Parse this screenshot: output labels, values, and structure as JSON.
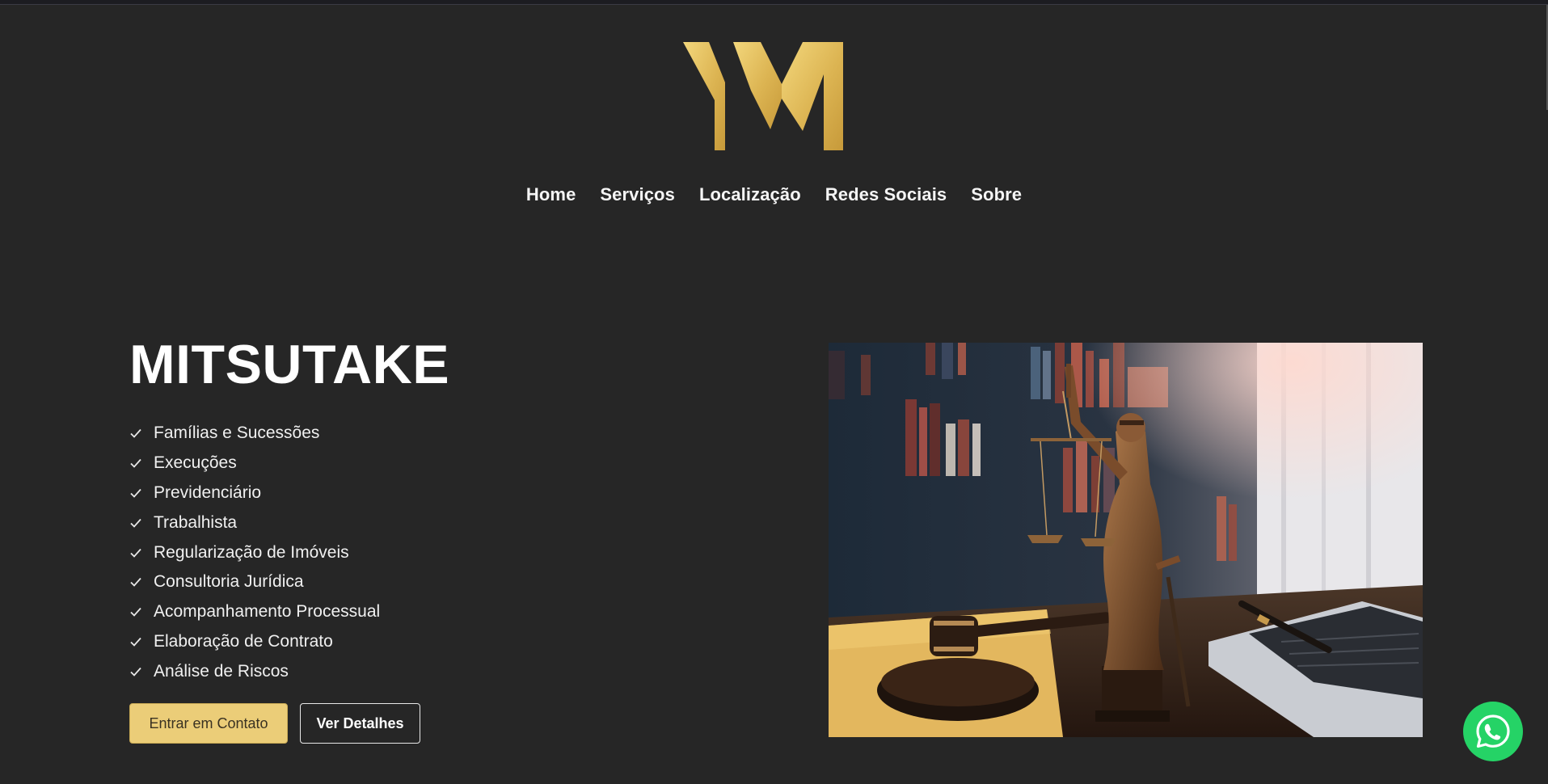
{
  "brand": {
    "logo_icon": "ym-monogram-logo",
    "gold_light": "#f1d57a",
    "gold_dark": "#c9a03e"
  },
  "nav": {
    "items": [
      {
        "label": "Home"
      },
      {
        "label": "Serviços"
      },
      {
        "label": "Localização"
      },
      {
        "label": "Redes Sociais"
      },
      {
        "label": "Sobre"
      }
    ]
  },
  "hero": {
    "title": "MITSUTAKE",
    "services": [
      "Famílias e Sucessões",
      "Execuções",
      "Previdenciário",
      "Trabalhista",
      "Regularização de Imóveis",
      "Consultoria Jurídica",
      "Acompanhamento Processual",
      "Elaboração de Contrato",
      "Análise de Riscos"
    ],
    "buttons": {
      "contact_label": "Entrar em Contato",
      "details_label": "Ver Detalhes"
    },
    "image_icon": "lady-justice-law-desk-photo"
  },
  "floating": {
    "whatsapp_icon": "whatsapp-icon",
    "whatsapp_color": "#25d366"
  },
  "colors": {
    "background": "#262626",
    "button_contact_bg": "#ebcd78"
  }
}
